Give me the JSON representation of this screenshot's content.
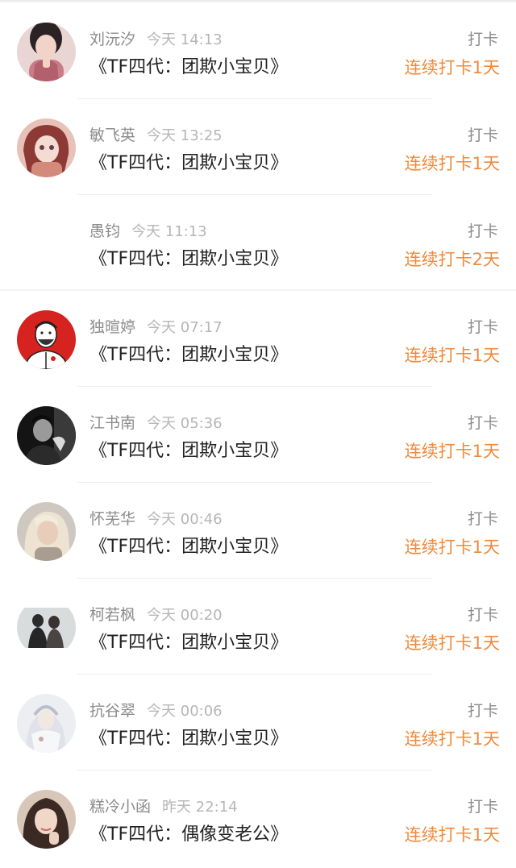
{
  "feed": {
    "items": [
      {
        "name": "刘沅汐",
        "time": "今天 14:13",
        "title": "《TF四代：团欺小宝贝》",
        "kind": "打卡",
        "streak": "连续打卡1天",
        "avatar": "avatar-girl-pink"
      },
      {
        "name": "敏飞英",
        "time": "今天 13:25",
        "title": "《TF四代：团欺小宝贝》",
        "kind": "打卡",
        "streak": "连续打卡1天",
        "avatar": "avatar-anime-girl"
      },
      {
        "name": "愚钧",
        "time": "今天 11:13",
        "title": "《TF四代：团欺小宝贝》",
        "kind": "打卡",
        "streak": "连续打卡2天",
        "avatar": "avatar-blank"
      },
      {
        "name": "独暄婷",
        "time": "今天 07:17",
        "title": "《TF四代：团欺小宝贝》",
        "kind": "打卡",
        "streak": "连续打卡1天",
        "avatar": "avatar-cartoon-man"
      },
      {
        "name": "江书南",
        "time": "今天 05:36",
        "title": "《TF四代：团欺小宝贝》",
        "kind": "打卡",
        "streak": "连续打卡1天",
        "avatar": "avatar-dark-man"
      },
      {
        "name": "怀芜华",
        "time": "今天 00:46",
        "title": "《TF四代：团欺小宝贝》",
        "kind": "打卡",
        "streak": "连续打卡1天",
        "avatar": "avatar-blonde-girl"
      },
      {
        "name": "柯若枫",
        "time": "今天 00:20",
        "title": "《TF四代：团欺小宝贝》",
        "kind": "打卡",
        "streak": "连续打卡1天",
        "avatar": "avatar-couple"
      },
      {
        "name": "抗谷翠",
        "time": "今天 00:06",
        "title": "《TF四代：团欺小宝贝》",
        "kind": "打卡",
        "streak": "连续打卡1天",
        "avatar": "avatar-white-costume"
      },
      {
        "name": "糕冷小函",
        "time": "昨天 22:14",
        "title": "《TF四代：偶像变老公》",
        "kind": "打卡",
        "streak": "连续打卡1天",
        "avatar": "avatar-selfie-girl"
      }
    ]
  },
  "colors": {
    "streak": "#f08a3c",
    "name": "#8c8c8c",
    "time": "#b6b6b6",
    "title": "#222222"
  }
}
